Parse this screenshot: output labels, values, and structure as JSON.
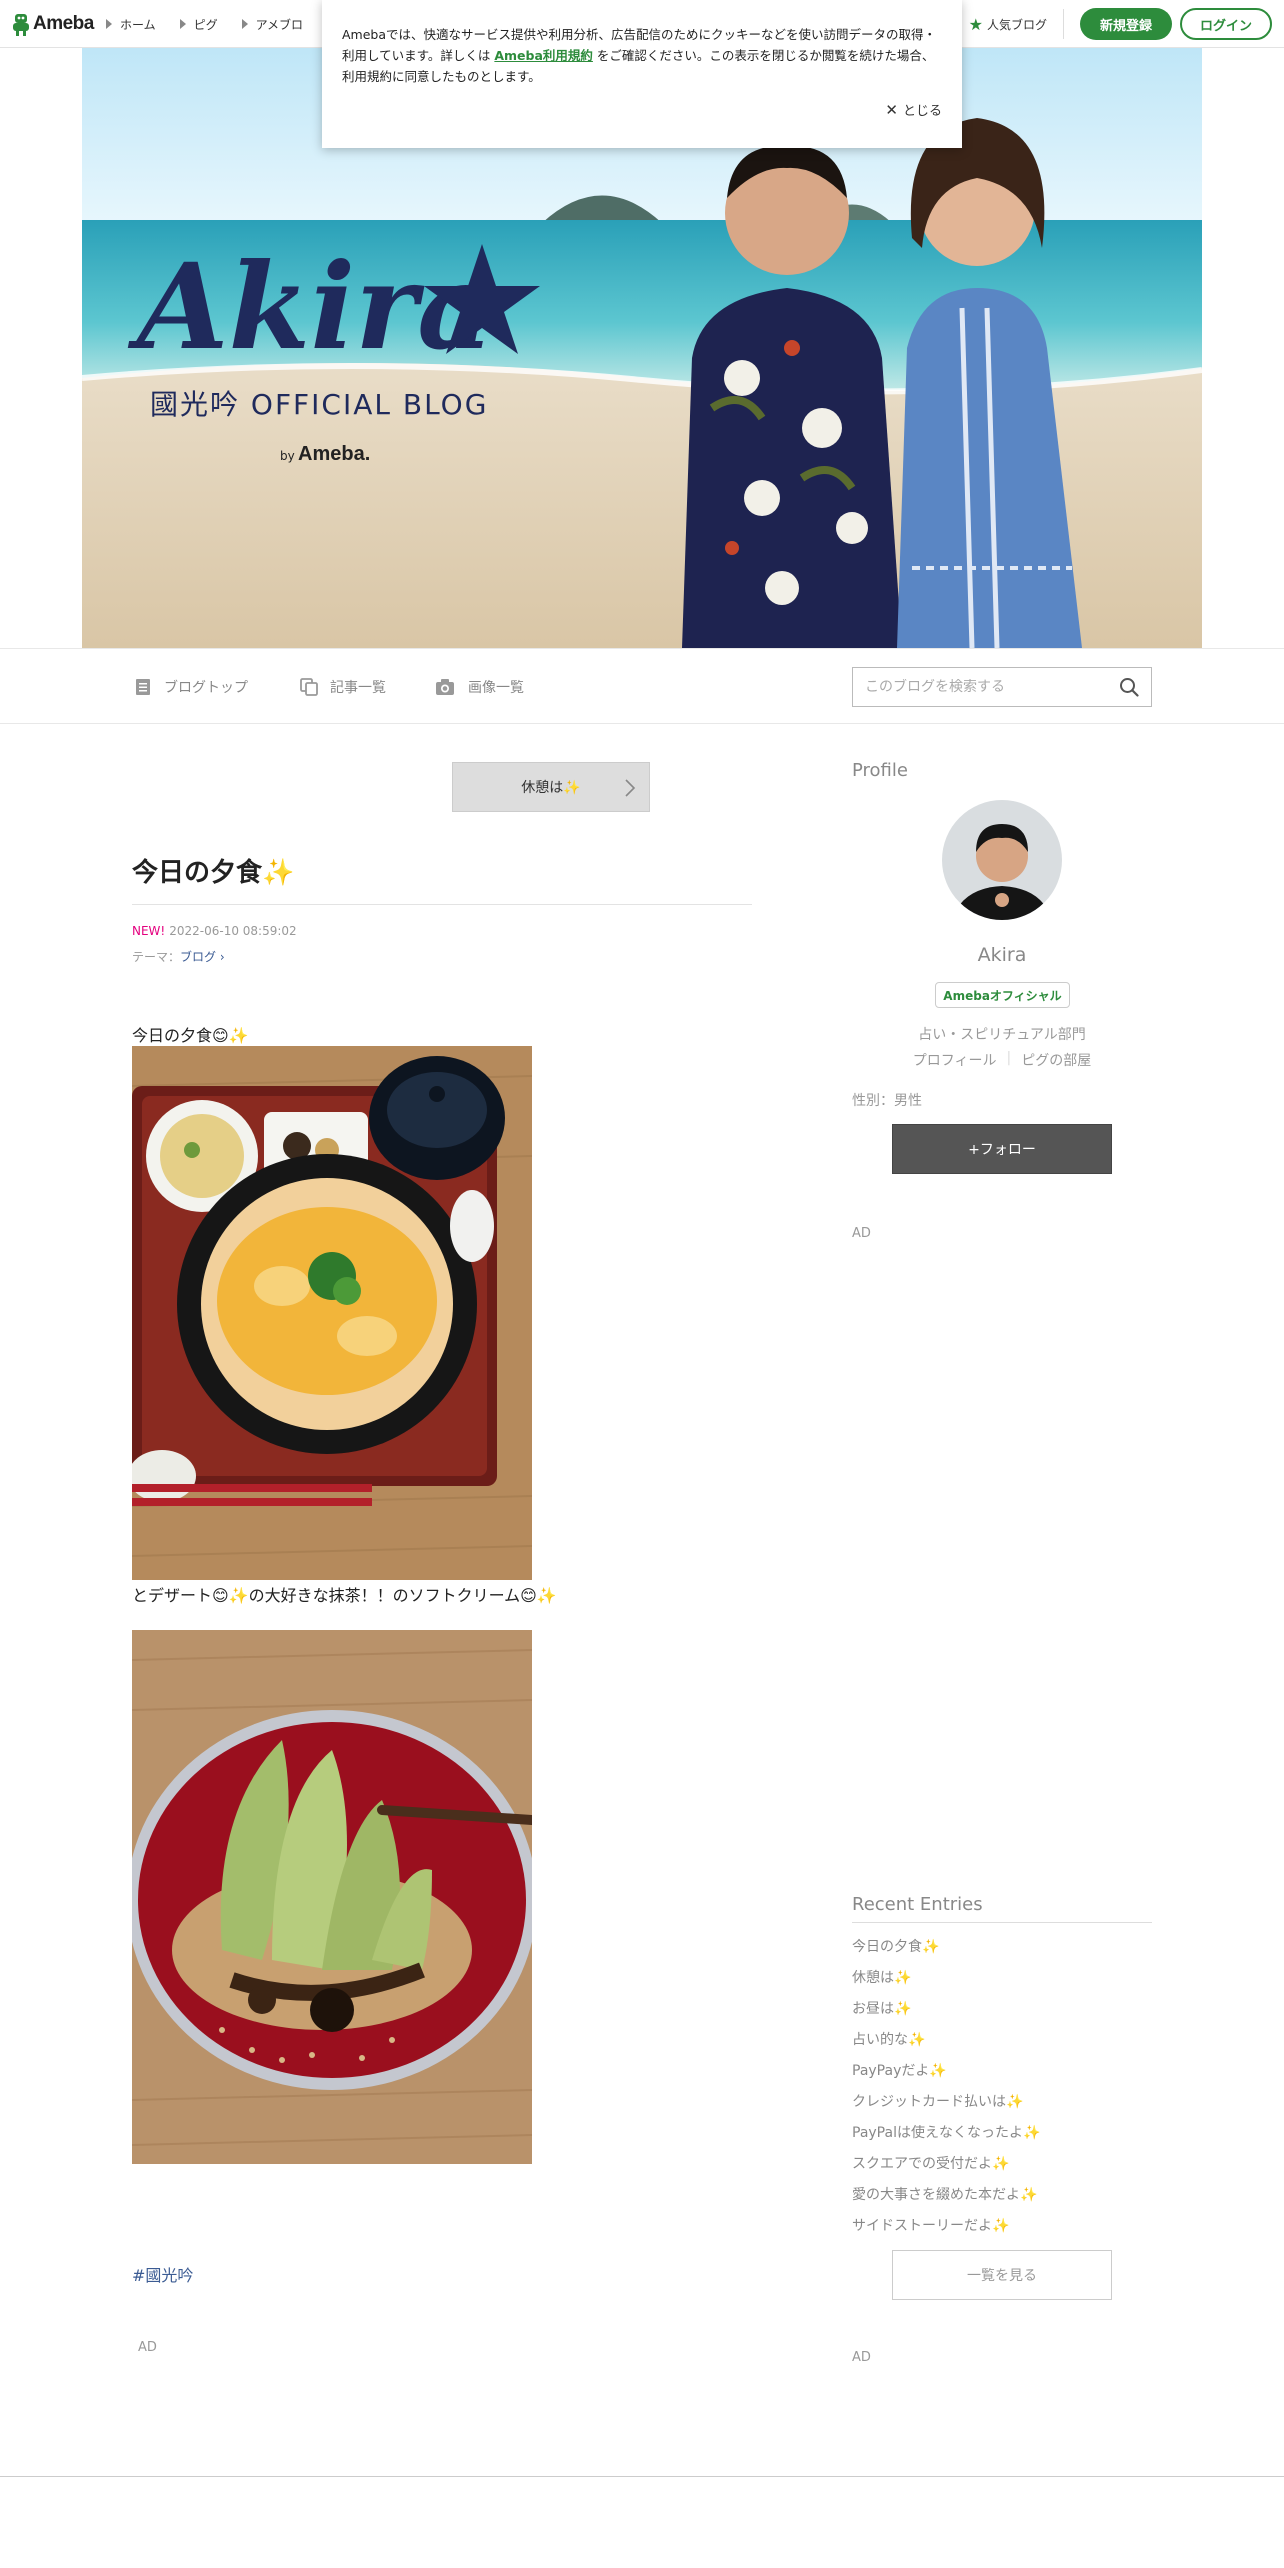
{
  "header": {
    "logo_text": "Ameba",
    "nav": [
      {
        "label": "ホーム"
      },
      {
        "label": "ピグ"
      },
      {
        "label": "アメブロ"
      }
    ],
    "popular_blog": "人気ブログ",
    "signup": "新規登録",
    "login": "ログイン"
  },
  "cookie": {
    "text_before": "Amebaでは、快適なサービス提供や利用分析、広告配信のためにクッキーなどを使い訪問データの取得・利用しています。詳しくは ",
    "link": "Ameba利用規約",
    "text_after": " をご確認ください。この表示を閉じるか閲覧を続けた場合、利用規約に同意したものとします。",
    "close": "とじる"
  },
  "banner": {
    "script_title": "Akira",
    "subtitle": "國光吟 OFFICIAL BLOG",
    "by": "by",
    "by_brand": "Ameba."
  },
  "blog_nav": {
    "top": "ブログトップ",
    "entries": "記事一覧",
    "images": "画像一覧",
    "search_placeholder": "このブログを検索する"
  },
  "article": {
    "prev_label": "休憩は✨",
    "title": "今日の夕食✨",
    "new": "NEW!",
    "date": "2022-06-10 08:59:02",
    "theme_prefix": "テーマ：",
    "theme": "ブログ",
    "line1": "今日の夕食😊✨",
    "line2": "とデザート😊✨の大好きな抹茶！！のソフトクリーム😊✨",
    "hashtag": "#國光吟",
    "ad": "AD"
  },
  "sidebar": {
    "profile_heading": "Profile",
    "name": "Akira",
    "badge": "Amebaオフィシャル",
    "category": "占い・スピリチュアル部門",
    "profile_link": "プロフィール",
    "pig_link": "ピグの部屋",
    "gender": "性別：男性",
    "follow": "+フォロー",
    "ad1": "AD",
    "recent_heading": "Recent Entries",
    "recent": [
      "今日の夕食✨",
      "休憩は✨",
      "お昼は✨",
      "占い的な✨",
      "PayPayだよ✨",
      "クレジットカード払いは✨",
      "PayPalは使えなくなったよ✨",
      "スクエアでの受付だよ✨",
      "愛の大事さを綴めた本だよ✨",
      "サイドストーリーだよ✨"
    ],
    "see_all": "一覧を見る",
    "ad2": "AD"
  },
  "colors": {
    "ameba_green": "#2d8c3c",
    "new_pink": "#e4007f",
    "link_blue": "#3b5b93",
    "banner_navy": "#1f2a5c"
  }
}
